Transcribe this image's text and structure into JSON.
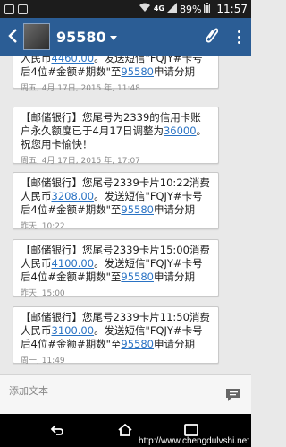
{
  "status": {
    "battery": "89%",
    "time": "11:57",
    "network": "4G"
  },
  "header": {
    "contact": "95580"
  },
  "messages": [
    {
      "parts": [
        "人民币",
        "4460.00",
        "。发送短信\"FQJY#卡号后4位#金额#期数\"至",
        "95580",
        "申请分期"
      ],
      "time": "周五, 4月 17日, 2015 年, 11:48"
    },
    {
      "parts": [
        "【邮储银行】您尾号为2339的信用卡账户永久额度已于4月17日调整为",
        "36000",
        "。祝您用卡愉快！"
      ],
      "time": "周五, 4月 17日, 2015 年, 17:07"
    },
    {
      "parts": [
        "【邮储银行】您尾号2339卡片10:22消费人民币",
        "3208.00",
        "。发送短信\"FQJY#卡号后4位#金额#期数\"至",
        "95580",
        "申请分期"
      ],
      "time": "昨天, 10:22"
    },
    {
      "parts": [
        "【邮储银行】您尾号2339卡片15:00消费人民币",
        "4100.00",
        "。发送短信\"FQJY#卡号后4位#金额#期数\"至",
        "95580",
        "申请分期"
      ],
      "time": "昨天, 15:00"
    },
    {
      "parts": [
        "【邮储银行】您尾号2339卡片11:50消费人民币",
        "3100.00",
        "。发送短信\"FQJY#卡号后4位#金额#期数\"至",
        "95580",
        "申请分期"
      ],
      "time": "周一, 11:49"
    }
  ],
  "compose": {
    "placeholder": "添加文本"
  },
  "watermark": "http://www.chengdulvshi.net",
  "colors": {
    "appbar": "#2b5d95",
    "link": "#2a73c4"
  }
}
